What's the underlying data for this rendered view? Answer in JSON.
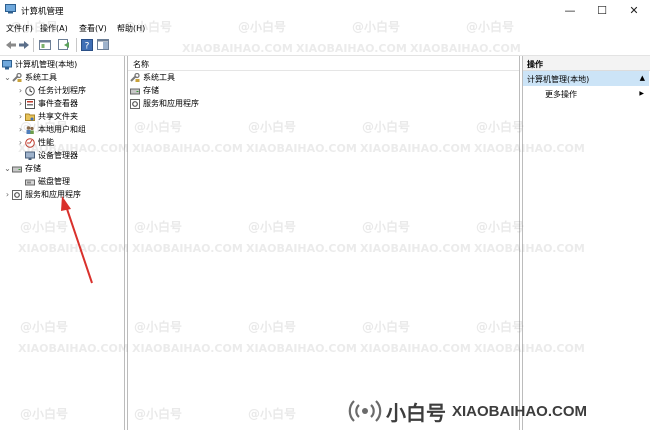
{
  "window": {
    "title": "计算机管理",
    "minimize_glyph": "—",
    "maximize_glyph": "☐",
    "close_glyph": "✕"
  },
  "menu": [
    "文件(F)",
    "操作(A)",
    "查看(V)",
    "帮助(H)"
  ],
  "toolbar": {
    "icons": [
      "back-arrow-icon",
      "forward-arrow-icon",
      "up-folder-icon",
      "properties-icon",
      "help-icon",
      "show-hide-pane-icon"
    ]
  },
  "tree": {
    "root": "计算机管理(本地)",
    "items": [
      {
        "label": "系统工具",
        "level": 1,
        "expanded": true,
        "icon": "tools-icon"
      },
      {
        "label": "任务计划程序",
        "level": 2,
        "expanded": false,
        "icon": "clock-icon"
      },
      {
        "label": "事件查看器",
        "level": 2,
        "expanded": false,
        "icon": "event-viewer-icon"
      },
      {
        "label": "共享文件夹",
        "level": 2,
        "expanded": false,
        "icon": "shared-folder-icon"
      },
      {
        "label": "本地用户和组",
        "level": 2,
        "expanded": false,
        "icon": "users-icon"
      },
      {
        "label": "性能",
        "level": 2,
        "expanded": false,
        "icon": "performance-icon"
      },
      {
        "label": "设备管理器",
        "level": 2,
        "expanded": null,
        "icon": "device-manager-icon"
      },
      {
        "label": "存储",
        "level": 1,
        "expanded": true,
        "icon": "storage-icon"
      },
      {
        "label": "磁盘管理",
        "level": 2,
        "expanded": null,
        "icon": "disk-icon"
      },
      {
        "label": "服务和应用程序",
        "level": 1,
        "expanded": false,
        "icon": "services-icon"
      }
    ]
  },
  "list": {
    "column_header": "名称",
    "items": [
      "系统工具",
      "存储",
      "服务和应用程序"
    ]
  },
  "actions": {
    "header": "操作",
    "section": "计算机管理(本地)",
    "more": "更多操作",
    "more_arrow": "▶",
    "collapse_arrow": "▲"
  },
  "watermark": {
    "text_a": "@小白号",
    "text_b": "XIAOBAIHAO.COM",
    "footer_brand": "小白号",
    "footer_url": "XIAOBAIHAO.COM"
  },
  "colors": {
    "selected": "#cce8ff",
    "arrow": "#d9312c"
  }
}
